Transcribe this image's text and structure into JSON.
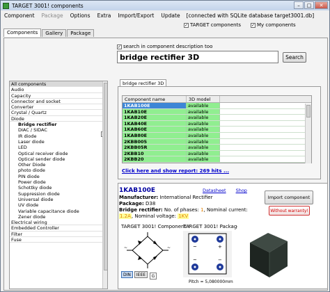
{
  "window": {
    "title": "TARGET 3001! components"
  },
  "menu": {
    "items": [
      "Component",
      "Package",
      "Options",
      "Extra",
      "Import/Export",
      "Update"
    ],
    "status": "[connected with SQLite database target3001.db]"
  },
  "checks": {
    "target": "TARGET components",
    "mine": "My components"
  },
  "tabs": [
    "Components",
    "Gallery",
    "Package"
  ],
  "search": {
    "desc_label": "search in component description too",
    "value": "bridge rectifier 3D",
    "button": "Search"
  },
  "categories": [
    {
      "label": "All components",
      "level": 0
    },
    {
      "label": "Audio",
      "level": 0
    },
    {
      "label": "Capacity",
      "level": 0
    },
    {
      "label": "Connector and socket",
      "level": 0
    },
    {
      "label": "Converter",
      "level": 0
    },
    {
      "label": "Crystal / Quartz",
      "level": 0
    },
    {
      "label": "Diode",
      "level": 0
    },
    {
      "label": "Bridge rectifier",
      "level": 1
    },
    {
      "label": "DIAC / SIDAC",
      "level": 1
    },
    {
      "label": "IR diode",
      "level": 1
    },
    {
      "label": "Laser diode",
      "level": 1
    },
    {
      "label": "LED",
      "level": 1
    },
    {
      "label": "Optical receiver diode",
      "level": 1
    },
    {
      "label": "Optical sender diode",
      "level": 1
    },
    {
      "label": "Other Diode",
      "level": 1
    },
    {
      "label": "photo diode",
      "level": 1
    },
    {
      "label": "PIN diode",
      "level": 1
    },
    {
      "label": "Power diode",
      "level": 1
    },
    {
      "label": "Schottky diode",
      "level": 1
    },
    {
      "label": "Suppression diode",
      "level": 1
    },
    {
      "label": "Universal diode",
      "level": 1
    },
    {
      "label": "UV diode",
      "level": 1
    },
    {
      "label": "Variable capacitance diode",
      "level": 1
    },
    {
      "label": "Zener diode",
      "level": 1
    },
    {
      "label": "Electrical wiring",
      "level": 0
    },
    {
      "label": "Embedded Controller",
      "level": 0
    },
    {
      "label": "Filter",
      "level": 0
    },
    {
      "label": "Fuse",
      "level": 0
    }
  ],
  "cat_dots": "...",
  "results": {
    "tab": "bridge rectifier 3D",
    "col_name": "Component name",
    "col_model": "3D model",
    "rows": [
      {
        "name": "1KAB100E",
        "model": "available"
      },
      {
        "name": "1KAB10E",
        "model": "available"
      },
      {
        "name": "1KAB20E",
        "model": "available"
      },
      {
        "name": "1KAB40E",
        "model": "available"
      },
      {
        "name": "1KAB60E",
        "model": "available"
      },
      {
        "name": "1KAB80E",
        "model": "available"
      },
      {
        "name": "2KBB005",
        "model": "available"
      },
      {
        "name": "2KBB05R",
        "model": "available"
      },
      {
        "name": "2KBB10",
        "model": "available"
      },
      {
        "name": "2KBB20",
        "model": "available"
      }
    ],
    "show_link": "Click here and show report: 269 hits ..."
  },
  "detail": {
    "name": "1KAB100E",
    "datasheet": "Datasheet",
    "shop": "Shop",
    "manufacturer_label": "Manufacturer:",
    "manufacturer": "International Rectifier",
    "package_label": "Package:",
    "package": "D38",
    "function_label": "Bridge rectifier:",
    "phases_text": "No. of phases:",
    "phases": "1",
    "current_text": ", Nominal current:",
    "current": "1.2A",
    "voltage_text": ", Nominal voltage:",
    "voltage": "1KV",
    "import_button": "Import component",
    "warranty_button": "Without warranty!"
  },
  "preview": {
    "symbol_title": "TARGET 3001! Component !",
    "package_title": "TARGET 3001! Package!",
    "sym_tabs": [
      "DIN",
      "IEEE"
    ],
    "g_button": "G",
    "pitch": "Pitch = 5,080000mm"
  },
  "colors": {
    "available_green": "#90ee90",
    "selection_blue": "#3d86d6",
    "highlight_yellow": "#ffff99"
  }
}
